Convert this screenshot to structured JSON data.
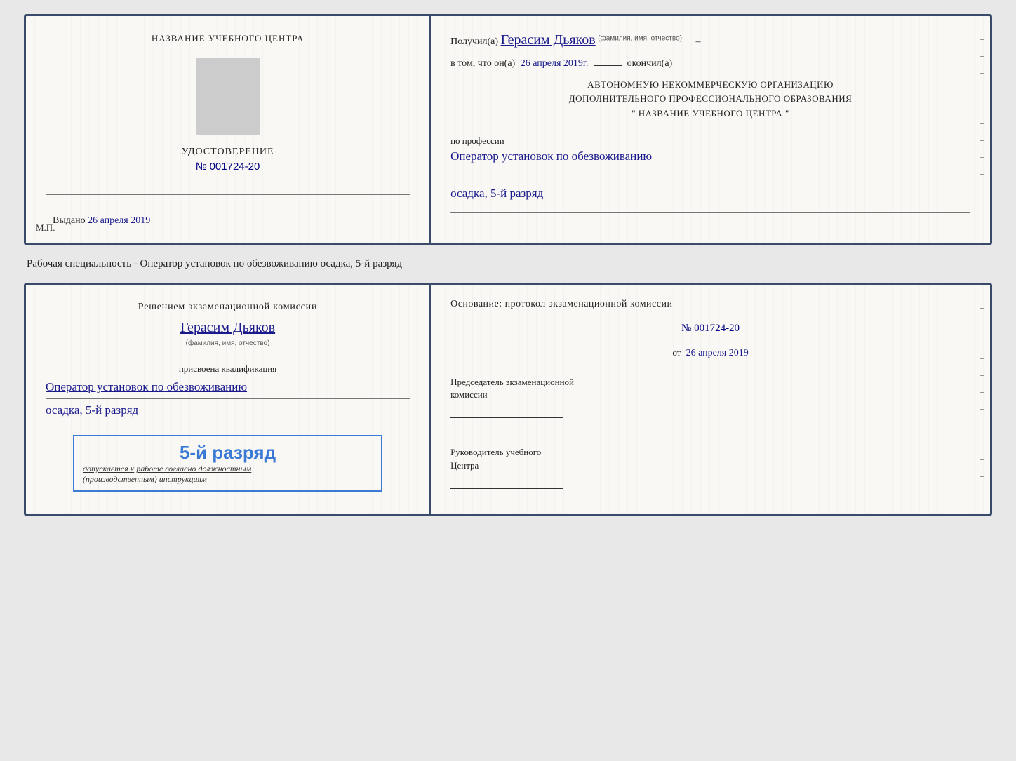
{
  "card1": {
    "left": {
      "center_label": "НАЗВАНИЕ УЧЕБНОГО ЦЕНТРА",
      "cert_title": "УДОСТОВЕРЕНИЕ",
      "cert_number_prefix": "№",
      "cert_number": "001724-20",
      "issued_prefix": "Выдано",
      "issued_date": "26 апреля 2019",
      "mp_label": "М.П."
    },
    "right": {
      "received_prefix": "Получил(а)",
      "recipient_name": "Герасим Дьяков",
      "fio_label": "(фамилия, имя, отчество)",
      "cert_fact_prefix": "в том, что он(а)",
      "cert_date": "26 апреля 2019г.",
      "cert_fact_suffix": "окончил(а)",
      "org_line1": "АВТОНОМНУЮ НЕКОММЕРЧЕСКУЮ ОРГАНИЗАЦИЮ",
      "org_line2": "ДОПОЛНИТЕЛЬНОГО ПРОФЕССИОНАЛЬНОГО ОБРАЗОВАНИЯ",
      "org_line3": "\"  НАЗВАНИЕ УЧЕБНОГО ЦЕНТРА  \"",
      "profession_label": "по профессии",
      "profession_value": "Оператор установок по обезвоживанию",
      "profession_value2": "осадка, 5-й разряд"
    }
  },
  "annotation": "Рабочая специальность - Оператор установок по обезвоживанию осадка, 5-й разряд",
  "card2": {
    "left": {
      "decision_label": "Решением экзаменационной комиссии",
      "person_name": "Герасим Дьяков",
      "fio_label": "(фамилия, имя, отчество)",
      "qualification_label": "присвоена квалификация",
      "qualification_value": "Оператор установок по обезвоживанию",
      "qualification_value2": "осадка, 5-й разряд",
      "stamp_title": "5-й разряд",
      "stamp_text": "допускается к",
      "stamp_underline": "работе согласно должностным",
      "stamp_italic": "(производственным) инструкциям"
    },
    "right": {
      "basis_label": "Основание: протокол экзаменационной комиссии",
      "protocol_prefix": "№",
      "protocol_number": "001724-20",
      "from_prefix": "от",
      "from_date": "26 апреля 2019",
      "chairman_label": "Председатель экзаменационной",
      "chairman_label2": "комиссии",
      "director_label": "Руководитель учебного",
      "director_label2": "Центра"
    }
  }
}
